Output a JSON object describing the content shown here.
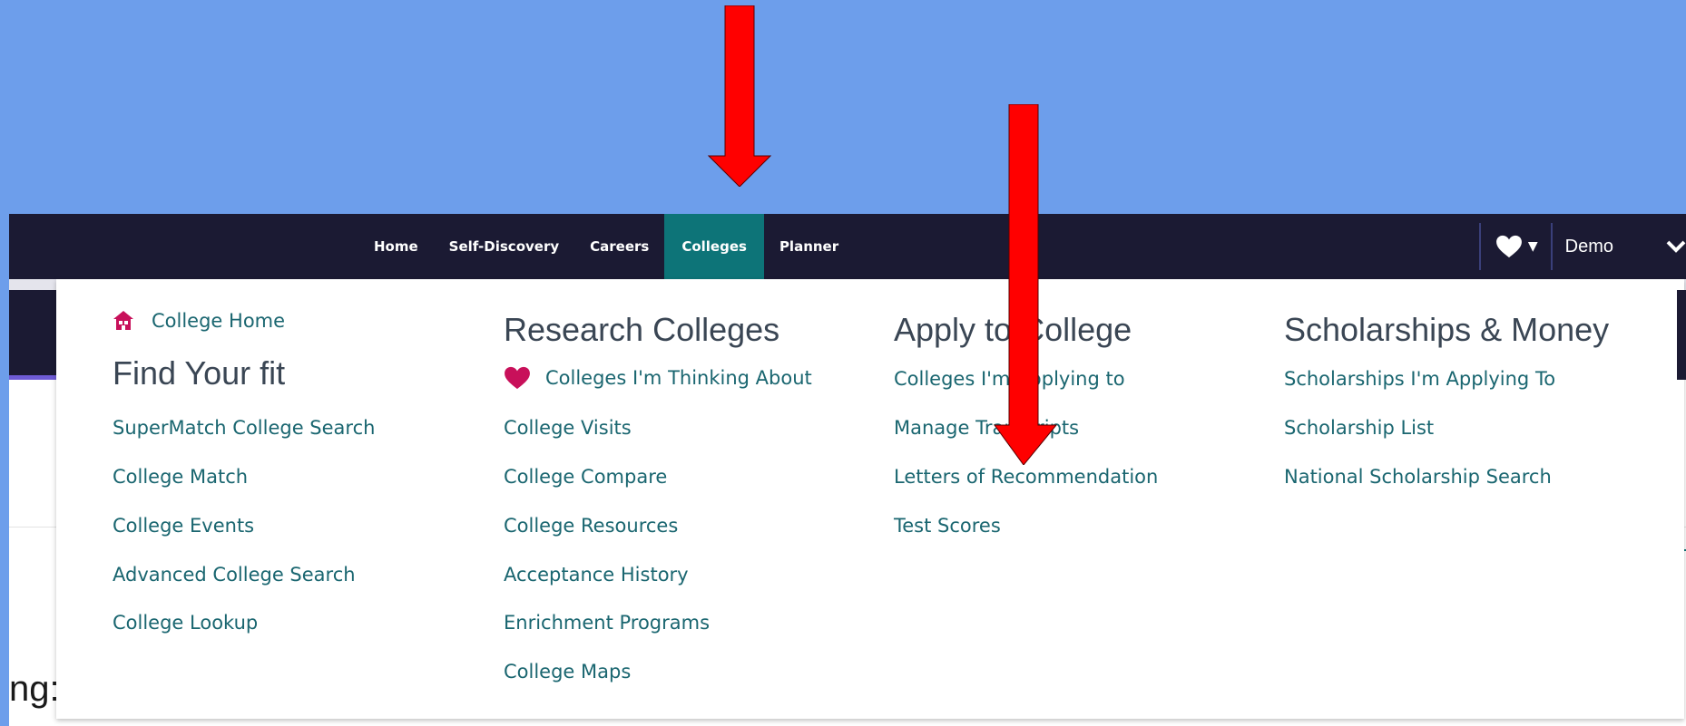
{
  "nav": {
    "links": [
      "Home",
      "Self-Discovery",
      "Careers",
      "Colleges",
      "Planner"
    ],
    "active": "Colleges",
    "user_name": "Demo"
  },
  "menu": {
    "col1": {
      "home_link": "College Home",
      "title": "Find Your fit",
      "links": [
        "SuperMatch College Search",
        "College Match",
        "College Events",
        "Advanced College Search",
        "College Lookup"
      ]
    },
    "col2": {
      "title": "Research Colleges",
      "links": [
        "Colleges I'm Thinking About",
        "College Visits",
        "College Compare",
        "College Resources",
        "Acceptance History",
        "Enrichment Programs",
        "College Maps"
      ]
    },
    "col3": {
      "title": "Apply to College",
      "links": [
        "Colleges I'm Applying to",
        "Manage Transcripts",
        "Letters of Recommendation",
        "Test Scores"
      ]
    },
    "col4": {
      "title": "Scholarships & Money",
      "links": [
        "Scholarships I'm Applying To",
        "Scholarship List",
        "National Scholarship Search"
      ]
    }
  },
  "page": {
    "partial_heading": "ng:",
    "edge_text": "ic"
  },
  "colors": {
    "background": "#6d9eeb",
    "navbar": "#1b1a33",
    "active_tab": "#0d7478",
    "link": "#1a6670",
    "accent_pink": "#c8105a",
    "arrow": "#ff0000"
  },
  "icons": {
    "college_home": "house-icon",
    "thinking_about": "heart-icon",
    "favorites": "heart-icon",
    "user_menu": "chevron-down-icon"
  }
}
